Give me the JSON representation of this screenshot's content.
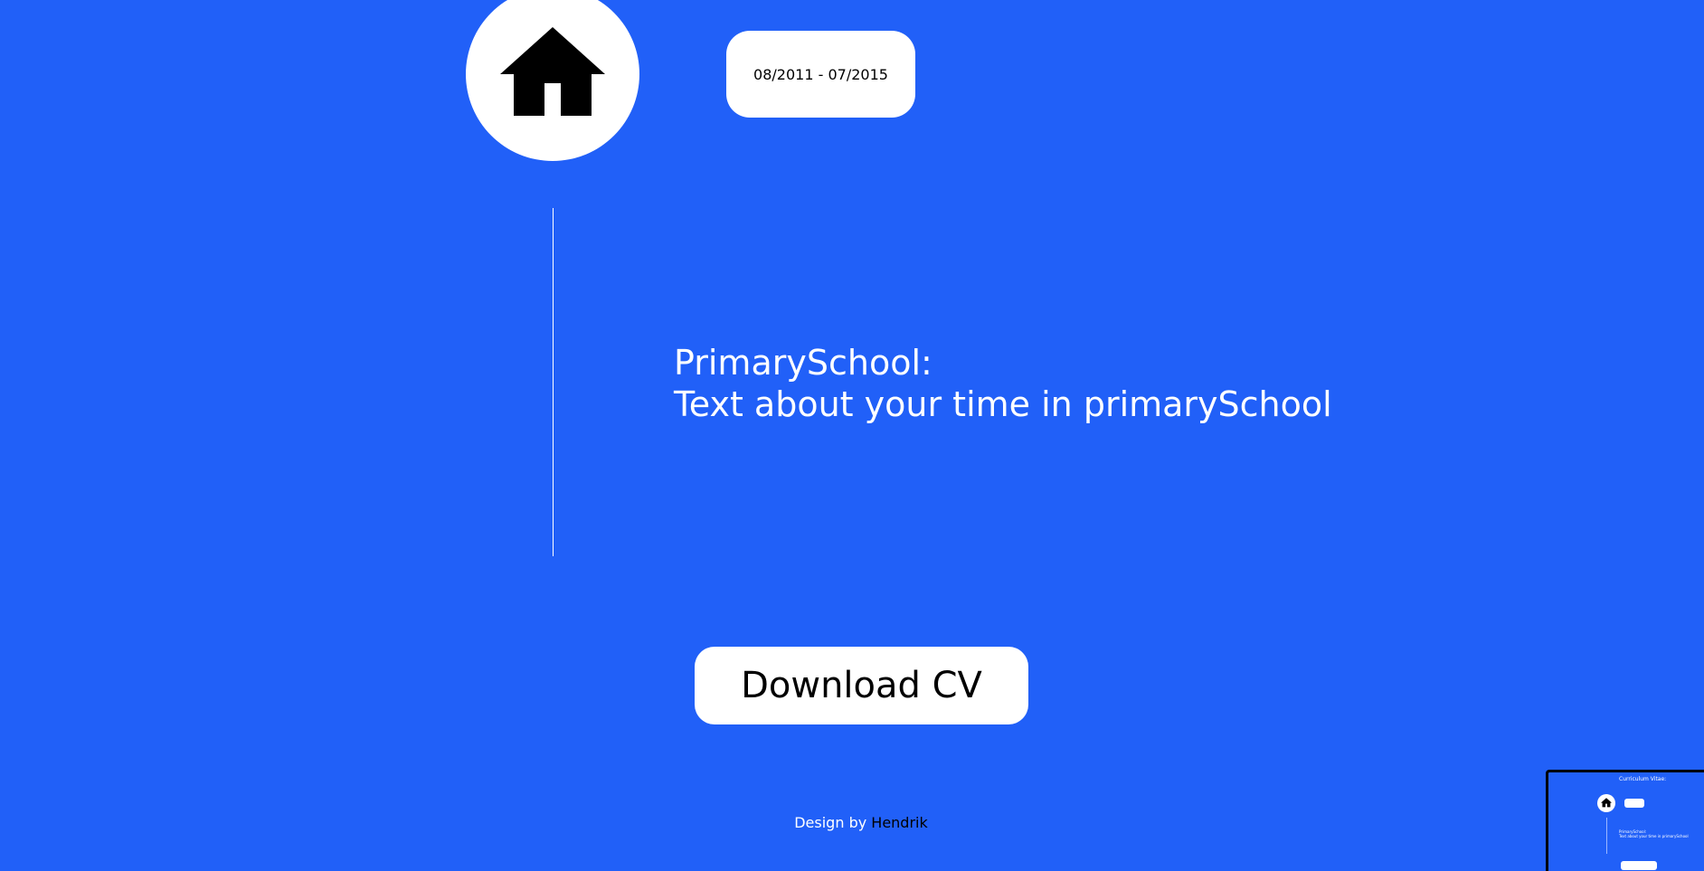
{
  "timeline": {
    "icon": "home-icon",
    "date_range": "08/2011 - 07/2015",
    "entry_title": "PrimarySchool:",
    "entry_description": "Text about your time in primarySchool"
  },
  "download": {
    "label": "Download CV"
  },
  "footer": {
    "prefix": "Design by",
    "author": "Hendrik"
  },
  "minimap": {
    "title": "Curriculum Vitae:",
    "entry_title": "PrimarySchool:",
    "entry_description": "Text about your time in primarySchool"
  },
  "colors": {
    "background": "#2160f8",
    "card": "#ffffff",
    "text_dark": "#000000",
    "text_light": "#ffffff"
  }
}
